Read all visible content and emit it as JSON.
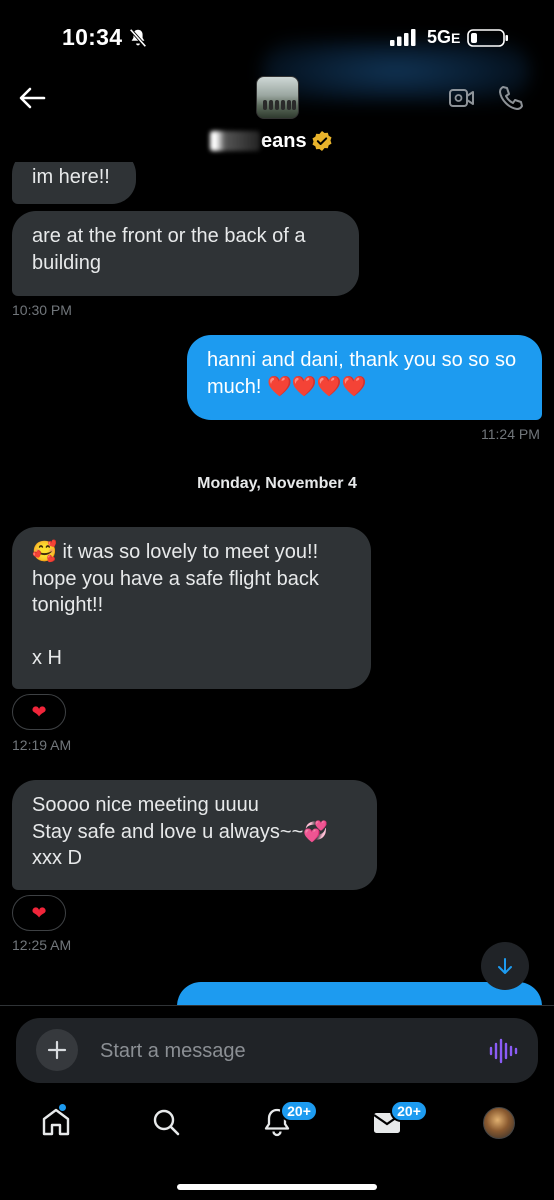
{
  "status_bar": {
    "time": "10:34",
    "network": "5G",
    "network_suffix": "E"
  },
  "header": {
    "contact_name": "Jeans",
    "name_visible": "eans",
    "verified_color": "#e8b32b"
  },
  "messages": [
    {
      "direction": "in",
      "text": "im here!!"
    },
    {
      "direction": "in",
      "text": "are at the front or the back of a building"
    },
    {
      "direction": "out",
      "text": "hanni and dani, thank you so so so much! ❤️❤️❤️❤️"
    },
    {
      "direction": "in",
      "text": "🥰 it was so lovely to meet you!!\nhope you have a safe flight back tonight!!\n\nx H"
    },
    {
      "direction": "in",
      "text": "Soooo nice meeting uuuu\nStay safe and love u always~~💞\nxxx D"
    }
  ],
  "timestamps": {
    "t1": "10:30 PM",
    "t2": "11:24 PM",
    "t3": "12:19 AM",
    "t4": "12:25 AM"
  },
  "day_separator": "Monday, November 4",
  "reactions": [
    "❤",
    "❤"
  ],
  "composer": {
    "placeholder": "Start a message"
  },
  "tabbar": {
    "notifications_badge": "20+",
    "messages_badge": "20+"
  },
  "colors": {
    "accent": "#1d9bf0",
    "incoming_bubble": "#2f3336",
    "voice_icon": "#8b5cf6"
  }
}
